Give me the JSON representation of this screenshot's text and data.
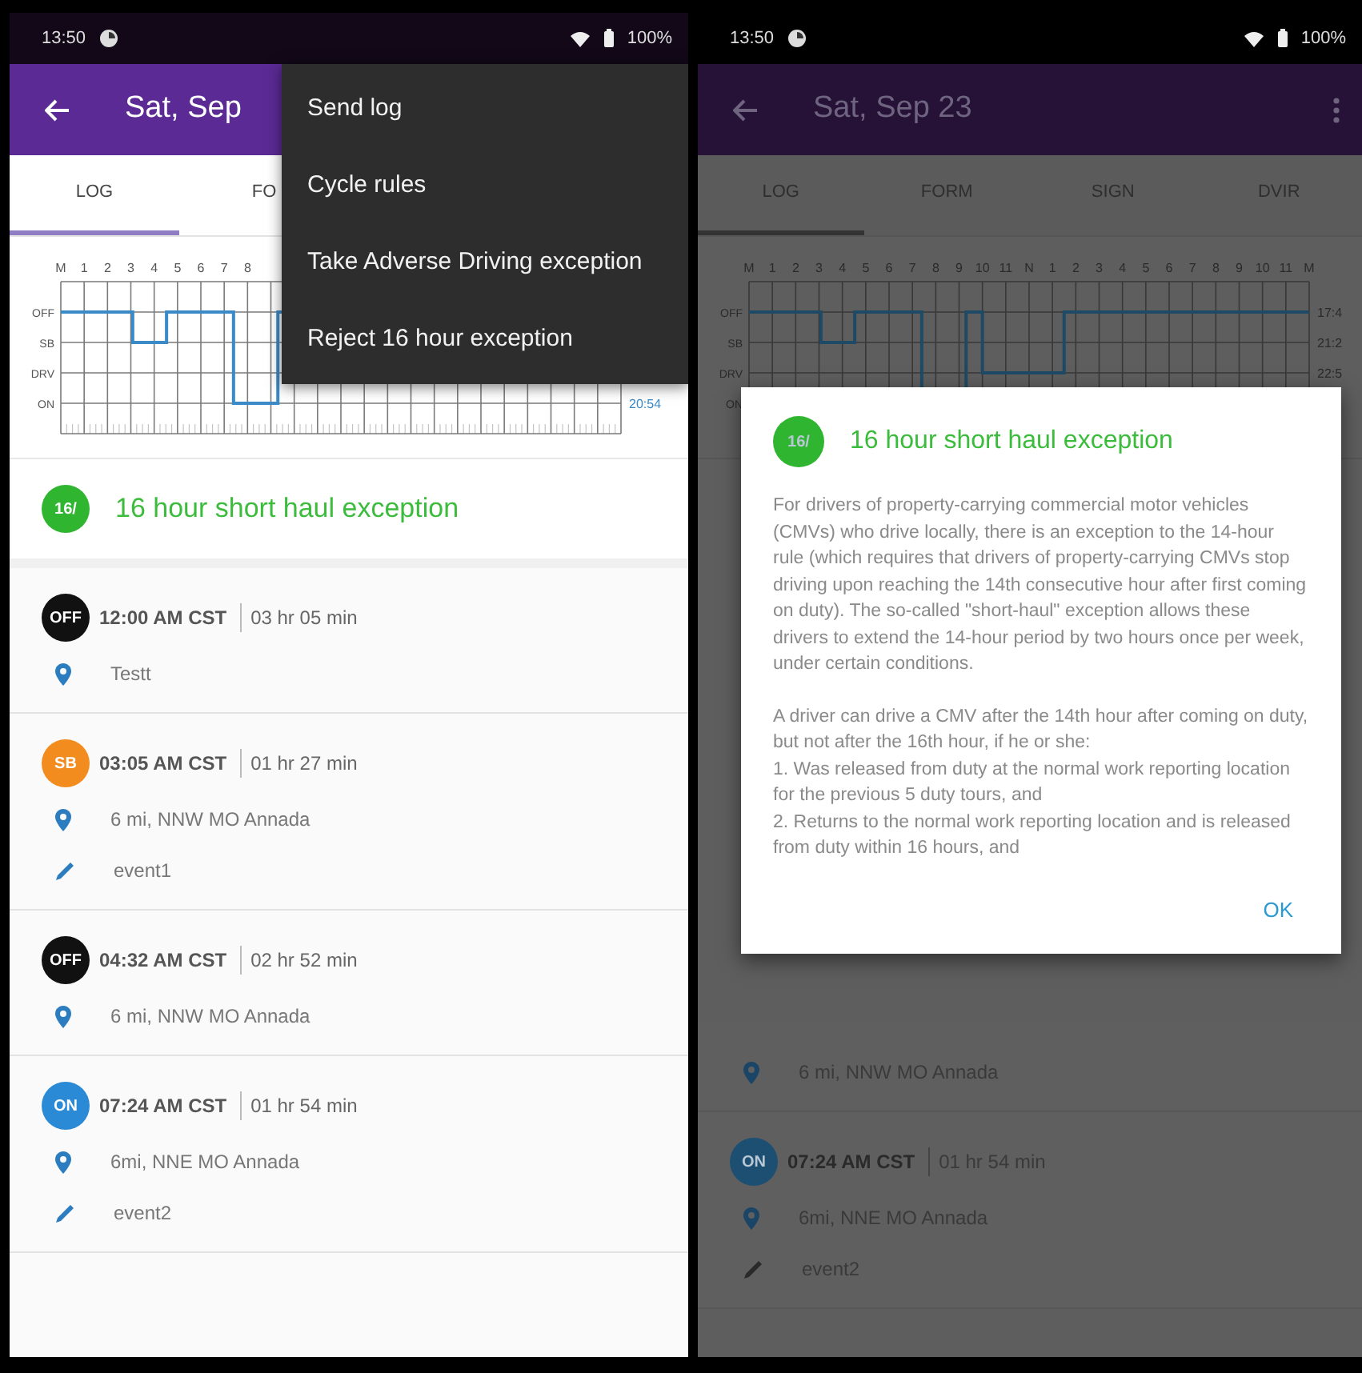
{
  "phones": [
    {
      "dimmed": false,
      "status_bar": {
        "time": "13:50",
        "battery": "100%"
      },
      "app_bar": {
        "title": "Sat, Sep"
      },
      "tabs": [
        {
          "label": "LOG",
          "selected": true
        },
        {
          "label": "FO",
          "selected": false
        }
      ],
      "log_graph": {
        "hours": [
          "M",
          "1",
          "2",
          "3",
          "4",
          "5",
          "6",
          "7",
          "8"
        ],
        "rows": [
          {
            "label": "OFF"
          },
          {
            "label": "SB"
          },
          {
            "label": "DRV"
          },
          {
            "label": "ON",
            "reading": "20:54"
          }
        ]
      },
      "exception": {
        "badge": "16/",
        "title": "16 hour short haul exception"
      },
      "events": [
        {
          "status": "OFF",
          "color": "#111111",
          "time": "12:00 AM CST",
          "duration": "03 hr 05 min",
          "details": [
            {
              "kind": "location",
              "text": "Testt"
            }
          ]
        },
        {
          "status": "SB",
          "color": "#f28c1e",
          "time": "03:05 AM CST",
          "duration": "01 hr 27 min",
          "details": [
            {
              "kind": "location",
              "text": "6 mi, NNW MO Annada"
            },
            {
              "kind": "note",
              "text": "event1"
            }
          ]
        },
        {
          "status": "OFF",
          "color": "#111111",
          "time": "04:32 AM CST",
          "duration": "02 hr 52 min",
          "details": [
            {
              "kind": "location",
              "text": "6 mi, NNW MO Annada"
            }
          ]
        },
        {
          "status": "ON",
          "color": "#2b8ad6",
          "time": "07:24 AM CST",
          "duration": "01 hr 54 min",
          "details": [
            {
              "kind": "location",
              "text": "6mi, NNE MO Annada"
            },
            {
              "kind": "note",
              "text": "event2"
            }
          ]
        }
      ],
      "menu": {
        "items": [
          "Send log",
          "Cycle rules",
          "Take Adverse Driving exception",
          "Reject 16 hour exception"
        ]
      }
    },
    {
      "dimmed": true,
      "status_bar": {
        "time": "13:50",
        "battery": "100%"
      },
      "app_bar": {
        "title": "Sat, Sep 23",
        "overflow_icon": true
      },
      "tabs": [
        {
          "label": "LOG",
          "selected": true
        },
        {
          "label": "FORM",
          "selected": false
        },
        {
          "label": "SIGN",
          "selected": false
        },
        {
          "label": "DVIR",
          "selected": false
        }
      ],
      "log_graph": {
        "hours": [
          "M",
          "1",
          "2",
          "3",
          "4",
          "5",
          "6",
          "7",
          "8",
          "9",
          "10",
          "11",
          "N",
          "1",
          "2",
          "3",
          "4",
          "5",
          "6",
          "7",
          "8",
          "9",
          "10",
          "11",
          "M"
        ],
        "rows": [
          {
            "label": "OFF",
            "reading": "17:4"
          },
          {
            "label": "SB",
            "reading": "21:2"
          },
          {
            "label": "DRV",
            "reading": "22:5"
          },
          {
            "label": "ON"
          }
        ]
      },
      "events": [
        {
          "details": [
            {
              "kind": "location",
              "text": "6 mi, NNW MO Annada"
            }
          ]
        },
        {
          "status": "ON",
          "color": "#1d4f73",
          "time": "07:24 AM CST",
          "duration": "01 hr 54 min",
          "details": [
            {
              "kind": "location",
              "text": "6mi, NNE MO Annada"
            },
            {
              "kind": "note",
              "text": "event2"
            }
          ]
        }
      ],
      "dialog": {
        "badge": "16/",
        "title": "16 hour short haul exception",
        "paragraphs": [
          [
            "For drivers of property-carrying commercial motor vehicles (CMVs) who drive locally, there is an exception to the 14-hour rule (which requires that drivers of property-carrying CMVs stop driving upon reaching the 14th consecutive hour after first coming on duty). The so-called \"short-haul\" exception allows these drivers to extend the 14-hour period by two hours once per week, under certain conditions."
          ],
          [
            "A driver can drive a CMV after the 14th hour after coming on duty, but not after the 16th hour, if he or she:",
            "1. Was released from duty at the normal work reporting location for the previous 5 duty tours, and",
            "2. Returns to the normal work reporting location and is released from duty within 16 hours, and"
          ]
        ],
        "button": "OK"
      }
    }
  ]
}
